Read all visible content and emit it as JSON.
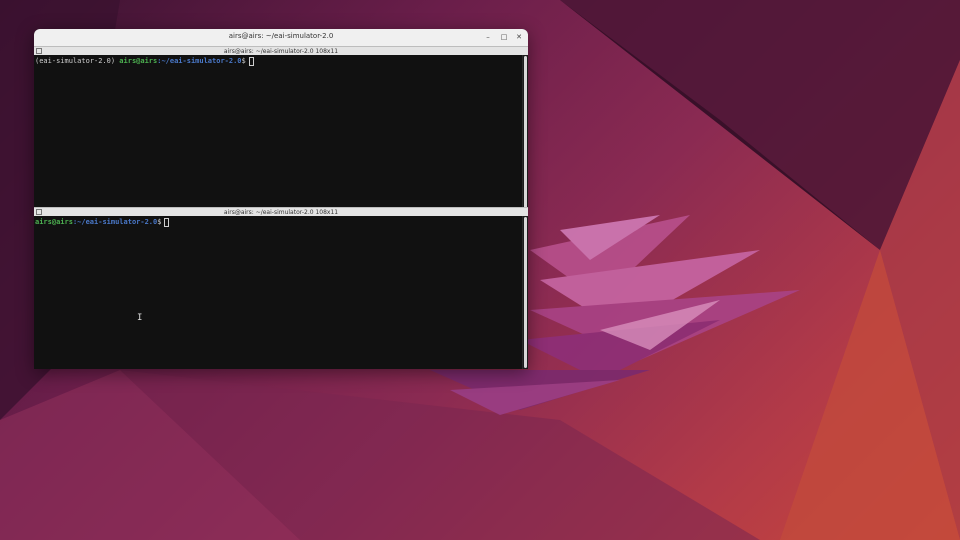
{
  "window": {
    "title": "airs@airs: ~/eai-simulator-2.0",
    "minimize_glyph": "–",
    "maximize_glyph": "□",
    "close_glyph": "✕"
  },
  "panes": [
    {
      "header": "airs@airs: ~/eai-simulator-2.0 108x11",
      "venv": "(eai-simulator-2.0) ",
      "userhost": "airs@airs",
      "path": ":~/eai-simulator-2.0",
      "dollar": "$"
    },
    {
      "header": "airs@airs: ~/eai-simulator-2.0 108x11",
      "venv": "",
      "userhost": "airs@airs",
      "path": ":~/eai-simulator-2.0",
      "dollar": "$"
    }
  ],
  "mouse_cursor": "I",
  "colors": {
    "terminal_bg": "#111111",
    "prompt_user": "#4caf50",
    "prompt_path": "#4a78c8",
    "wallpaper_accent": "#8a2a52"
  }
}
